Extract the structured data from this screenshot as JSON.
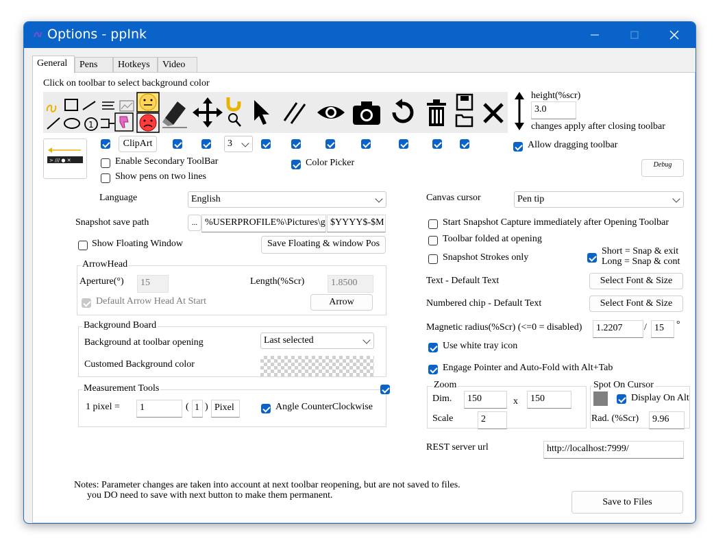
{
  "window": {
    "title": "Options - ppInk"
  },
  "tabs": [
    "General",
    "Pens",
    "Hotkeys",
    "Video"
  ],
  "toolbar_section": {
    "hint": "Click on toolbar to select background color",
    "clipart_label": "ClipArt",
    "pen_count": "3",
    "enable_secondary": "Enable Secondary ToolBar",
    "show_pens_two_lines": "Show pens on two lines",
    "color_picker": "Color Picker",
    "height_label": "height(%scr)",
    "height_value": "3.0",
    "changes_note": "changes apply after closing toolbar",
    "allow_dragging": "Allow dragging toolbar",
    "debug": "Debug"
  },
  "left": {
    "language_label": "Language",
    "language_value": "English",
    "snapshot_label": "Snapshot save path",
    "snapshot_browse": "...",
    "snapshot_path": "%USERPROFILE%\\Pictures\\g",
    "snapshot_pattern": "$YYYY$-$M",
    "show_floating": "Show Floating Window",
    "save_floating": "Save Floating & window Pos",
    "arrowhead": {
      "title": "ArrowHead",
      "aperture_label": "Aperture(°)",
      "aperture_value": "15",
      "length_label": "Length(%Scr)",
      "length_value": "1.8500",
      "default_arrow": "Default Arrow Head At Start",
      "arrow_button": "Arrow"
    },
    "background": {
      "title": "Background Board",
      "opening_label": "Background at toolbar opening",
      "opening_value": "Last selected",
      "custom_label": "Customed Background color"
    },
    "measurement": {
      "title": "Measurement Tools",
      "pixel_label": "1 pixel =",
      "pixel_value": "1",
      "open_paren": "(",
      "pixel_count": "1",
      "close_paren": ")",
      "unit": "Pixel",
      "angle_ccw": "Angle CounterClockwise"
    }
  },
  "right": {
    "canvas_cursor_label": "Canvas cursor",
    "canvas_cursor_value": "Pen tip",
    "start_snapshot": "Start Snapshot Capture immediately after Opening Toolbar",
    "toolbar_folded": "Toolbar folded at opening",
    "snapshot_strokes": "Snapshot Strokes only",
    "short_snap": "Short = Snap & exit",
    "long_snap": "Long = Snap & cont",
    "text_label": "Text  - Default Text",
    "select_font": "Select Font & Size",
    "chip_label": "Numbered chip  - Default Text",
    "select_font2": "Select Font & Size",
    "magnetic_label": "Magnetic radius(%Scr) (<=0 = disabled)",
    "magnetic_value": "1.2207",
    "magnetic_sep": "/",
    "magnetic_angle": "15",
    "degree": "°",
    "white_tray": "Use white tray icon",
    "engage_pointer": "Engage Pointer and Auto-Fold with Alt+Tab",
    "zoom": {
      "title": "Zoom",
      "dim_label": "Dim.",
      "dim_w": "150",
      "x": "x",
      "dim_h": "150",
      "scale_label": "Scale",
      "scale_value": "2"
    },
    "spot": {
      "title": "Spot On Cursor",
      "display_alt": "Display On Alt",
      "rad_label": "Rad. (%Scr)",
      "rad_value": "9.96"
    },
    "rest_label": "REST server url",
    "rest_value": "http://localhost:7999/"
  },
  "notes": {
    "line1": "Notes: Parameter changes are taken into account at next toolbar reopening, but are not saved to files.",
    "line2": "you DO need to save with next button to make them permanent."
  },
  "save_button": "Save to Files",
  "colors": {
    "titlebar": "#0a63c9",
    "accent": "#0a63c9",
    "background": "#f0f0f0"
  }
}
